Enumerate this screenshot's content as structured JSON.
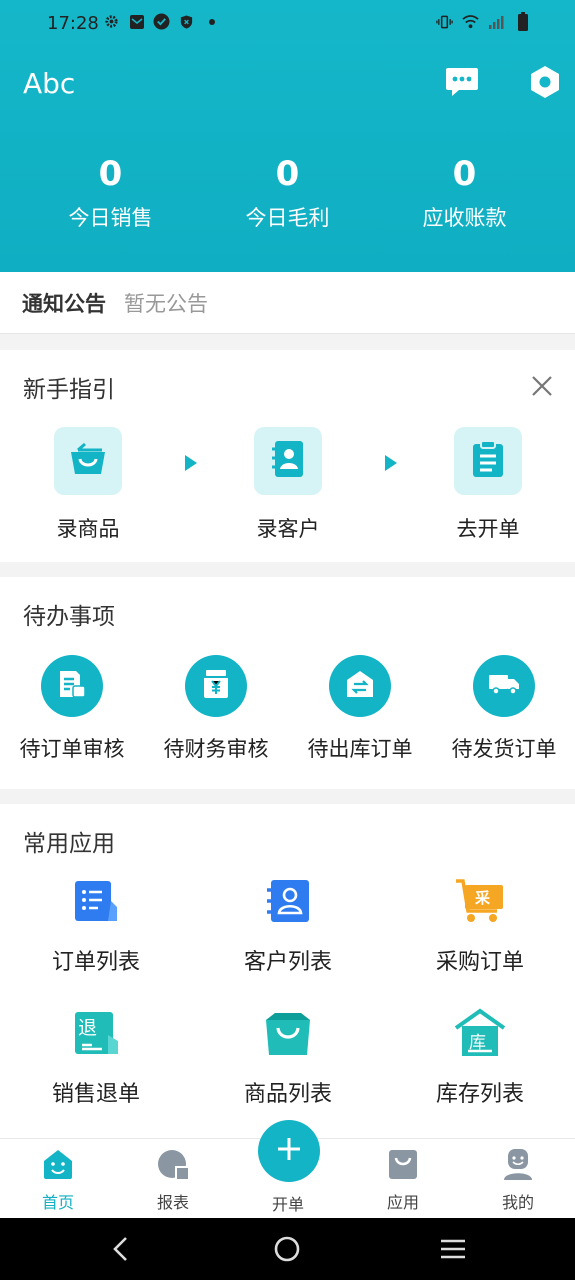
{
  "status_bar": {
    "time": "17:28",
    "icons": [
      "settings-status-icon",
      "mail-status-icon",
      "check-status-icon",
      "shield-status-icon",
      "dot-status-icon",
      "vibrate-icon",
      "wifi-icon",
      "signal-icon",
      "battery-icon"
    ]
  },
  "header": {
    "app_name": "Abc",
    "icons": [
      "chat-icon",
      "settings-icon"
    ],
    "stats": [
      {
        "value": "0",
        "label": "今日销售"
      },
      {
        "value": "0",
        "label": "今日毛利"
      },
      {
        "value": "0",
        "label": "应收账款"
      }
    ]
  },
  "notice": {
    "title": "通知公告",
    "text": "暂无公告"
  },
  "guide": {
    "title": "新手指引",
    "items": [
      {
        "label": "录商品",
        "icon": "basket-icon"
      },
      {
        "label": "录客户",
        "icon": "contact-book-icon"
      },
      {
        "label": "去开单",
        "icon": "clipboard-icon"
      }
    ]
  },
  "todo": {
    "title": "待办事项",
    "items": [
      {
        "label": "待订单审核",
        "icon": "order-review-icon"
      },
      {
        "label": "待财务审核",
        "icon": "finance-review-icon"
      },
      {
        "label": "待出库订单",
        "icon": "warehouse-out-icon"
      },
      {
        "label": "待发货订单",
        "icon": "truck-icon"
      }
    ]
  },
  "apps": {
    "title": "常用应用",
    "items": [
      {
        "label": "订单列表",
        "icon": "order-list-icon"
      },
      {
        "label": "客户列表",
        "icon": "customer-list-icon"
      },
      {
        "label": "采购订单",
        "icon": "purchase-cart-icon",
        "badge": "采"
      },
      {
        "label": "销售退单",
        "icon": "sales-return-icon",
        "badge": "退"
      },
      {
        "label": "商品列表",
        "icon": "product-bag-icon"
      },
      {
        "label": "库存列表",
        "icon": "inventory-icon",
        "badge": "库"
      }
    ]
  },
  "tabbar": {
    "tabs": [
      {
        "label": "首页",
        "icon": "home-icon",
        "active": true
      },
      {
        "label": "报表",
        "icon": "report-icon",
        "active": false
      },
      {
        "label": "开单",
        "icon": "plus-icon",
        "active": false
      },
      {
        "label": "应用",
        "icon": "apps-bag-icon",
        "active": false
      },
      {
        "label": "我的",
        "icon": "profile-icon",
        "active": false
      }
    ]
  },
  "colors": {
    "primary": "#12b4c6",
    "primary_light": "#d6f3f6",
    "blue": "#2f7cf0",
    "orange": "#f5a623",
    "teal": "#1fbcb8"
  }
}
